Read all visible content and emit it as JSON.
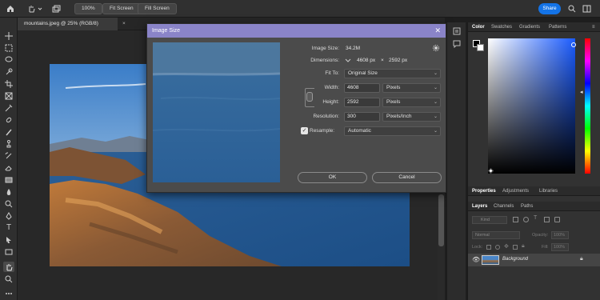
{
  "options_bar": {
    "zoom_label": "100%",
    "fit_screen_label": "Fit Screen",
    "fill_screen_label": "Fill Screen",
    "share_label": "Share"
  },
  "document": {
    "tab_title": "mountains.jpeg @ 25% (RGB/8)",
    "tab_close": "×"
  },
  "dialog": {
    "title": "Image Size",
    "close_glyph": "✕",
    "image_size_label": "Image Size:",
    "image_size_value": "34.2M",
    "dimensions_label": "Dimensions:",
    "dim_width": "4608 px",
    "dim_times": "×",
    "dim_height": "2592 px",
    "fit_to_label": "Fit To:",
    "fit_to_value": "Original Size",
    "width_label": "Width:",
    "width_value": "4608",
    "width_unit": "Pixels",
    "height_label": "Height:",
    "height_value": "2592",
    "height_unit": "Pixels",
    "resolution_label": "Resolution:",
    "resolution_value": "300",
    "resolution_unit": "Pixels/Inch",
    "resample_label": "Resample:",
    "resample_checked": true,
    "resample_value": "Automatic",
    "ok_label": "OK",
    "cancel_label": "Cancel"
  },
  "color_panel": {
    "tabs": [
      "Color",
      "Swatches",
      "Gradients",
      "Patterns"
    ]
  },
  "props_panel": {
    "tabs": [
      "Properties",
      "Adjustments",
      "Libraries"
    ]
  },
  "layers_panel": {
    "tabs": [
      "Layers",
      "Channels",
      "Paths"
    ],
    "filter_placeholder": "Kind",
    "blend_mode": "Normal",
    "opacity_label": "Opacity:",
    "opacity_value": "100%",
    "lock_label": "Lock:",
    "fill_label": "Fill:",
    "fill_value": "100%",
    "layers": [
      {
        "name": "Background",
        "visible": true,
        "locked": true
      }
    ]
  },
  "colors": {
    "accent": "#1473e6",
    "dialog_title": "#8a84c8",
    "panel_bg": "#323232"
  }
}
